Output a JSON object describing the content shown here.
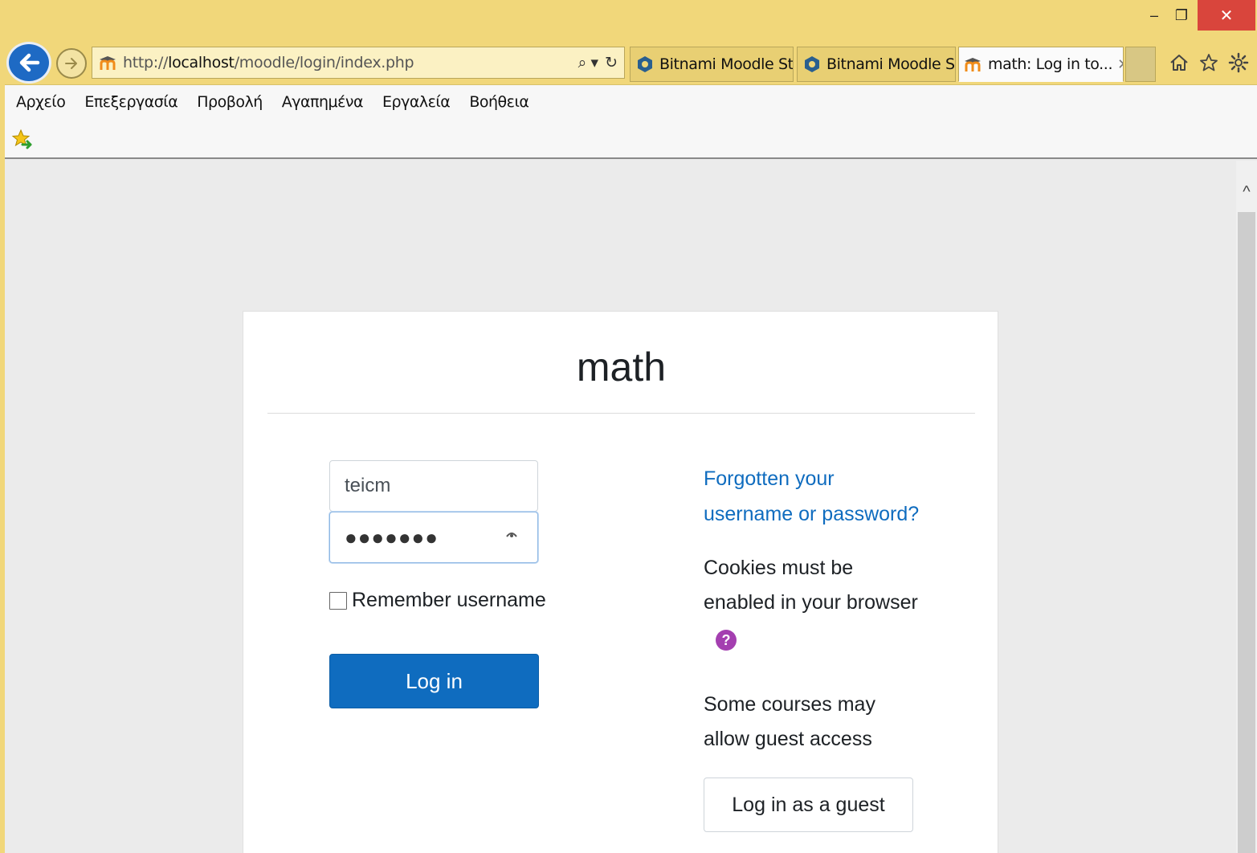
{
  "window": {
    "minimize_label": "‒",
    "maximize_label": "❐",
    "close_label": "✕"
  },
  "browser": {
    "url_scheme": "http://",
    "url_host": "localhost",
    "url_path": "/moodle/login/index.php",
    "address_tools": [
      "⌕ ▾",
      "↻"
    ],
    "tabs": [
      {
        "title": "Bitnami Moodle St...",
        "icon": "bitnami-icon",
        "active": false
      },
      {
        "title": "Bitnami Moodle S...",
        "icon": "bitnami-icon",
        "active": false
      },
      {
        "title": "math: Log in to...",
        "icon": "moodle-icon",
        "active": true,
        "close": "✕"
      }
    ],
    "toolbar": [
      "home-icon",
      "favorites-star-icon",
      "settings-gear-icon"
    ]
  },
  "menubar": {
    "items": [
      "Αρχείο",
      "Επεξεργασία",
      "Προβολή",
      "Αγαπημένα",
      "Εργαλεία",
      "Βοήθεια"
    ]
  },
  "login": {
    "site_title": "math",
    "username_value": "teicm",
    "password_mask": "●●●●●●●",
    "remember_label": "Remember username",
    "login_button": "Log in",
    "forgot_line1": "Forgotten your",
    "forgot_line2": "username or password?",
    "cookies_line1": "Cookies must be",
    "cookies_line2": "enabled in your browser",
    "help_glyph": "?",
    "guest_line1": "Some courses may",
    "guest_line2": "allow guest access",
    "guest_button": "Log in as a guest"
  },
  "colors": {
    "brand_blue": "#0f6cbf",
    "help_purple": "#a43fb0",
    "ie_titlebar": "#f1d77a"
  }
}
